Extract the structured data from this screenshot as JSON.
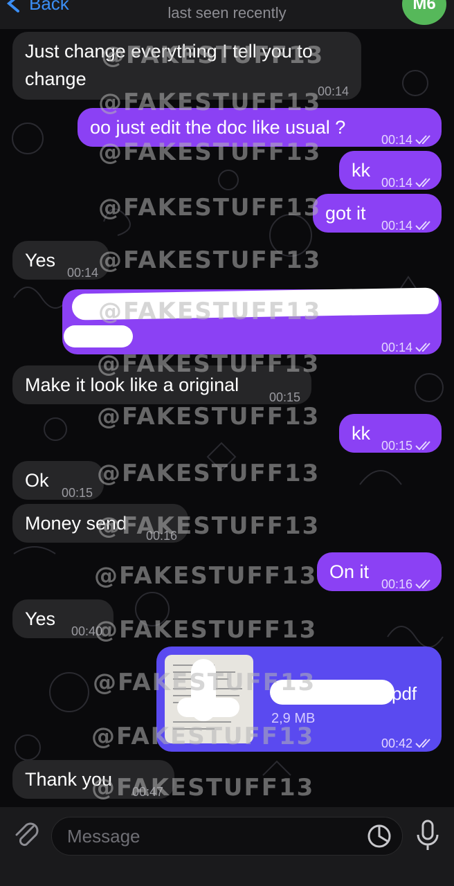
{
  "header": {
    "back_label": "Back",
    "status": "last seen recently",
    "avatar_initials": "M6",
    "avatar_color": "#56b85a"
  },
  "colors": {
    "incoming_bubble": "#262628",
    "outgoing_bubble": "#8b41f4",
    "file_bubble": "#5a4af0",
    "accent": "#3b8ef5"
  },
  "messages": [
    {
      "dir": "in",
      "text": "Just change everything I tell you to change",
      "line1": "Just change everything I tell you to",
      "line2": "change",
      "time": "00:14"
    },
    {
      "dir": "out",
      "text": "oo just edit the doc like usual ?",
      "time": "00:14"
    },
    {
      "dir": "out",
      "text": "kk",
      "time": "00:14"
    },
    {
      "dir": "out",
      "text": "got it",
      "time": "00:14"
    },
    {
      "dir": "in",
      "text": "Yes",
      "time": "00:14"
    },
    {
      "dir": "out",
      "text": "",
      "time": "00:14",
      "redacted": true
    },
    {
      "dir": "in",
      "text": "Make it look like a original",
      "time": "00:15"
    },
    {
      "dir": "out",
      "text": "kk",
      "time": "00:15"
    },
    {
      "dir": "in",
      "text": "Ok",
      "time": "00:15"
    },
    {
      "dir": "in",
      "text": "Money send",
      "time": "00:16"
    },
    {
      "dir": "out",
      "text": "On it",
      "time": "00:16"
    },
    {
      "dir": "in",
      "text": "Yes",
      "time": "00:40"
    },
    {
      "dir": "out",
      "type": "file",
      "file_ext": "pdf",
      "file_size": "2,9 MB",
      "time": "00:42"
    },
    {
      "dir": "in",
      "text": "Thank you",
      "time": "00:47"
    }
  ],
  "composer": {
    "placeholder": "Message"
  },
  "watermark": "@FAKESTUFF13"
}
